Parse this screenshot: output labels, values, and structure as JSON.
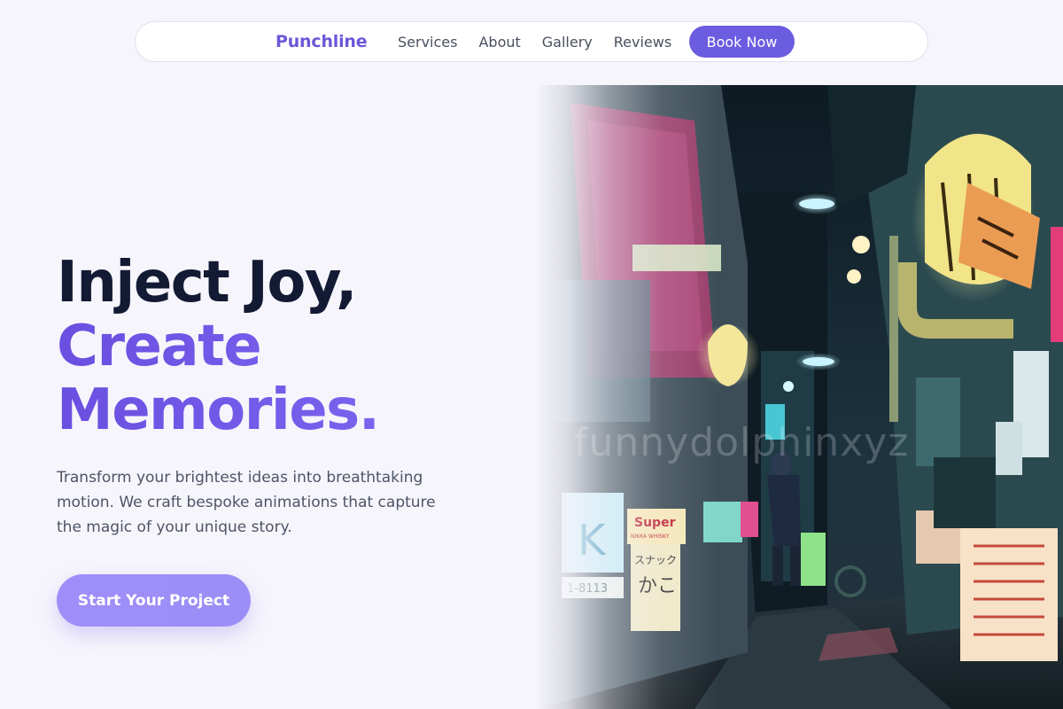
{
  "nav": {
    "brand": "Punchline",
    "links": [
      "Services",
      "About",
      "Gallery",
      "Reviews"
    ],
    "cta": "Book Now"
  },
  "hero": {
    "title_line1": "Inject Joy,",
    "title_line2": "Create",
    "title_line3": "Memories.",
    "subtitle": "Transform your brightest ideas into breathtaking motion. We craft bespoke animations that capture the magic of your unique story.",
    "cta": "Start Your Project"
  },
  "image": {
    "watermark": "funnydolphinxyz",
    "signs": {
      "super": "Super",
      "super_sub": "NIKKA WHISKY",
      "snack": "スナック",
      "kako": "かこ",
      "number": "1-8113"
    }
  },
  "colors": {
    "accent": "#6b5ce0",
    "brand": "#6c57d8",
    "heading_dark": "#131a33",
    "cta_light": "#9f8efa",
    "background": "#f6f5fc"
  }
}
